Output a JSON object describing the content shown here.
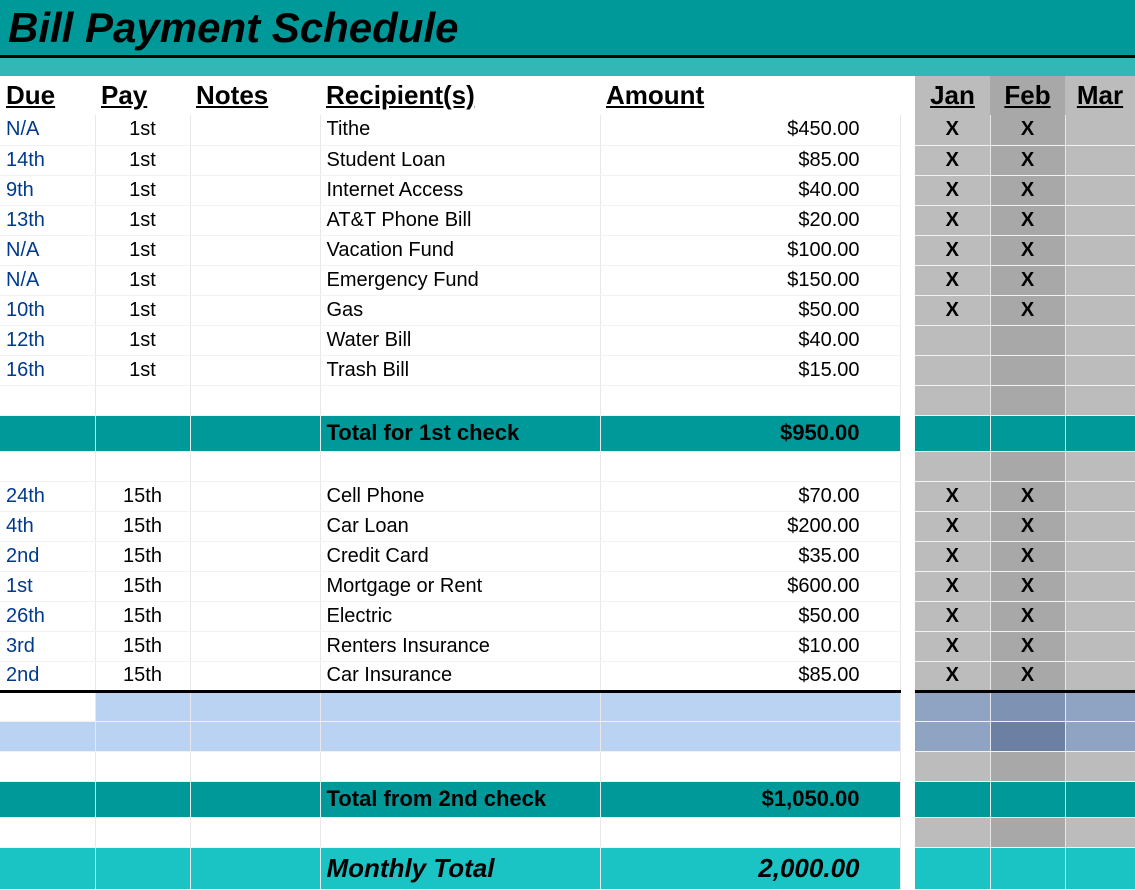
{
  "title": "Bill Payment Schedule",
  "headers": {
    "due": "Due",
    "pay": "Pay",
    "notes": "Notes",
    "recipient": "Recipient(s)",
    "amount": "Amount",
    "jan": "Jan",
    "feb": "Feb",
    "mar": "Mar"
  },
  "group1": [
    {
      "due": "N/A",
      "pay": "1st",
      "notes": "",
      "recipient": "Tithe",
      "amount": "$450.00",
      "jan": "X",
      "feb": "X",
      "mar": ""
    },
    {
      "due": "14th",
      "pay": "1st",
      "notes": "",
      "recipient": "Student Loan",
      "amount": "$85.00",
      "jan": "X",
      "feb": "X",
      "mar": ""
    },
    {
      "due": "9th",
      "pay": "1st",
      "notes": "",
      "recipient": "Internet Access",
      "amount": "$40.00",
      "jan": "X",
      "feb": "X",
      "mar": ""
    },
    {
      "due": "13th",
      "pay": "1st",
      "notes": "",
      "recipient": "AT&T Phone Bill",
      "amount": "$20.00",
      "jan": "X",
      "feb": "X",
      "mar": ""
    },
    {
      "due": "N/A",
      "pay": "1st",
      "notes": "",
      "recipient": "Vacation Fund",
      "amount": "$100.00",
      "jan": "X",
      "feb": "X",
      "mar": ""
    },
    {
      "due": "N/A",
      "pay": "1st",
      "notes": "",
      "recipient": "Emergency Fund",
      "amount": "$150.00",
      "jan": "X",
      "feb": "X",
      "mar": ""
    },
    {
      "due": "10th",
      "pay": "1st",
      "notes": "",
      "recipient": "Gas",
      "amount": "$50.00",
      "jan": "X",
      "feb": "X",
      "mar": ""
    },
    {
      "due": "12th",
      "pay": "1st",
      "notes": "",
      "recipient": "Water Bill",
      "amount": "$40.00",
      "jan": "",
      "feb": "",
      "mar": ""
    },
    {
      "due": "16th",
      "pay": "1st",
      "notes": "",
      "recipient": "Trash Bill",
      "amount": "$15.00",
      "jan": "",
      "feb": "",
      "mar": ""
    }
  ],
  "subtotal1": {
    "label": "Total for 1st check",
    "amount": "$950.00"
  },
  "group2": [
    {
      "due": "24th",
      "pay": "15th",
      "notes": "",
      "recipient": "Cell Phone",
      "amount": "$70.00",
      "jan": "X",
      "feb": "X",
      "mar": ""
    },
    {
      "due": "4th",
      "pay": "15th",
      "notes": "",
      "recipient": "Car Loan",
      "amount": "$200.00",
      "jan": "X",
      "feb": "X",
      "mar": ""
    },
    {
      "due": "2nd",
      "pay": "15th",
      "notes": "",
      "recipient": "Credit Card",
      "amount": "$35.00",
      "jan": "X",
      "feb": "X",
      "mar": ""
    },
    {
      "due": "1st",
      "pay": "15th",
      "notes": "",
      "recipient": "Mortgage or Rent",
      "amount": "$600.00",
      "jan": "X",
      "feb": "X",
      "mar": ""
    },
    {
      "due": "26th",
      "pay": "15th",
      "notes": "",
      "recipient": "Electric",
      "amount": "$50.00",
      "jan": "X",
      "feb": "X",
      "mar": ""
    },
    {
      "due": "3rd",
      "pay": "15th",
      "notes": "",
      "recipient": "Renters Insurance",
      "amount": "$10.00",
      "jan": "X",
      "feb": "X",
      "mar": ""
    },
    {
      "due": "2nd",
      "pay": "15th",
      "notes": "",
      "recipient": "Car Insurance",
      "amount": "$85.00",
      "jan": "X",
      "feb": "X",
      "mar": ""
    }
  ],
  "subtotal2": {
    "label": "Total from 2nd check",
    "amount": "$1,050.00"
  },
  "monthly": {
    "label": "Monthly Total",
    "amount": "2,000.00"
  }
}
